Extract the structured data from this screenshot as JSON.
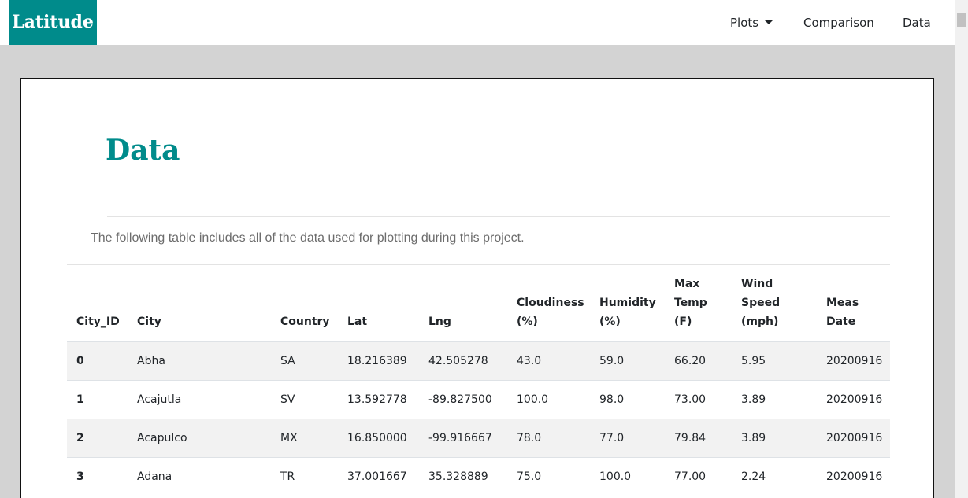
{
  "navbar": {
    "brand": "Latitude",
    "items": [
      {
        "label": "Plots"
      },
      {
        "label": "Comparison"
      },
      {
        "label": "Data"
      }
    ]
  },
  "main": {
    "title": "Data",
    "description": "The following table includes all of the data used for plotting during this project."
  },
  "table": {
    "headers": [
      {
        "line1": "City_ID"
      },
      {
        "line1": "City"
      },
      {
        "line1": "Country"
      },
      {
        "line1": "Lat"
      },
      {
        "line1": "Lng"
      },
      {
        "line1": "Cloudiness",
        "line2": "(%)"
      },
      {
        "line1": "Humidity",
        "line2": "(%)"
      },
      {
        "line1": "Max",
        "line2": "Temp",
        "line3": "(F)"
      },
      {
        "line1": "Wind",
        "line2": "Speed",
        "line3": "(mph)"
      },
      {
        "line1": "Meas",
        "line2": "Date"
      }
    ],
    "rows": [
      [
        "0",
        "Abha",
        "SA",
        "18.216389",
        "42.505278",
        "43.0",
        "59.0",
        "66.20",
        "5.95",
        "20200916"
      ],
      [
        "1",
        "Acajutla",
        "SV",
        "13.592778",
        "-89.827500",
        "100.0",
        "98.0",
        "73.00",
        "3.89",
        "20200916"
      ],
      [
        "2",
        "Acapulco",
        "MX",
        "16.850000",
        "-99.916667",
        "78.0",
        "77.0",
        "79.84",
        "3.89",
        "20200916"
      ],
      [
        "3",
        "Adana",
        "TR",
        "37.001667",
        "35.328889",
        "75.0",
        "100.0",
        "77.00",
        "2.24",
        "20200916"
      ]
    ]
  },
  "colors": {
    "accent": "#008b8b",
    "page_background": "#d3d3d3",
    "stripe": "#f2f2f2"
  }
}
